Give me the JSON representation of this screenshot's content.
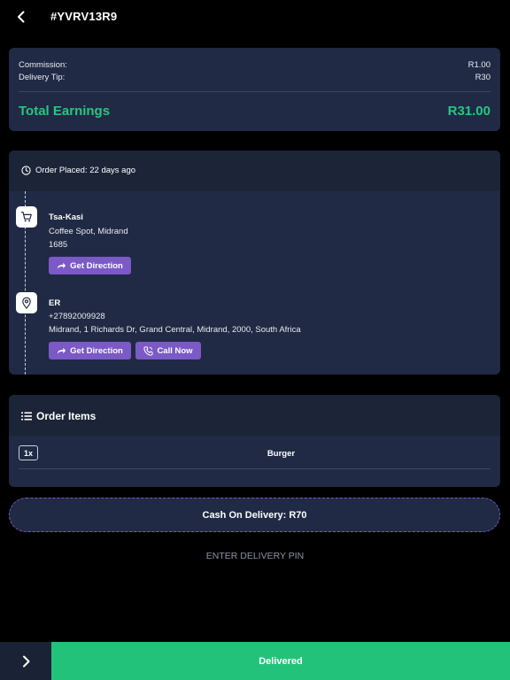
{
  "header": {
    "order_id": "#YVRV13R9",
    "back_icon": "chevron-left-icon"
  },
  "earnings": {
    "commission_label": "Commission:",
    "commission_value": "R1.00",
    "tip_label": "Delivery Tip:",
    "tip_value": "R30",
    "total_label": "Total Earnings",
    "total_value": "R31.00",
    "accent_color": "#25c782"
  },
  "order": {
    "placed_text": "Order Placed: 22 days ago",
    "pickup": {
      "icon": "cart-icon",
      "name": "Tsa-Kasi",
      "address_line1": "Coffee Spot, Midrand",
      "address_line2": "1685",
      "direction_label": "Get Direction"
    },
    "dropoff": {
      "icon": "location-pin-icon",
      "name": "ER",
      "phone": "+27892009928",
      "address": "Midrand, 1 Richards Dr, Grand Central, Midrand, 2000, South Africa",
      "direction_label": "Get Direction",
      "call_label": "Call Now"
    },
    "button_color": "#7b59c6"
  },
  "items": {
    "title": "Order Items",
    "list": [
      {
        "qty": "1x",
        "name": "Burger"
      }
    ]
  },
  "payment": {
    "cod_text": "Cash On Delivery: R70"
  },
  "pin": {
    "label": "ENTER DELIVERY PIN"
  },
  "footer": {
    "delivered_label": "Delivered",
    "delivered_color": "#22c27b"
  }
}
